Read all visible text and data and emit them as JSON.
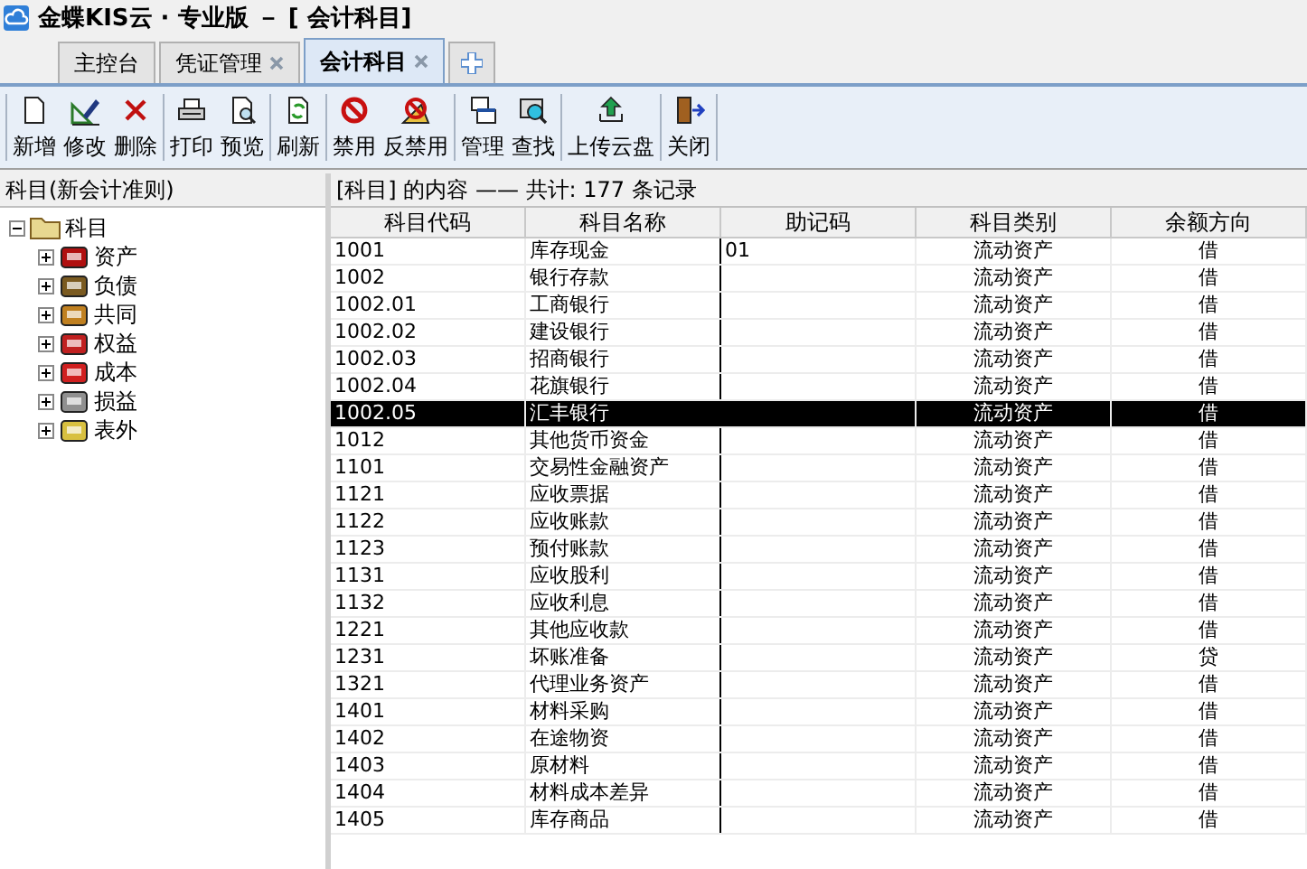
{
  "window": {
    "title": "金蝶KIS云 · 专业版 － [ 会计科目]"
  },
  "tabs": [
    {
      "label": "主控台",
      "selected": false,
      "closable": false
    },
    {
      "label": "凭证管理",
      "selected": false,
      "closable": true
    },
    {
      "label": "会计科目",
      "selected": true,
      "closable": true
    }
  ],
  "toolbar": [
    [
      {
        "label": "新增",
        "kind": "new"
      },
      {
        "label": "修改",
        "kind": "edit"
      },
      {
        "label": "删除",
        "kind": "delete"
      }
    ],
    [
      {
        "label": "打印",
        "kind": "print"
      },
      {
        "label": "预览",
        "kind": "preview"
      }
    ],
    [
      {
        "label": "刷新",
        "kind": "refresh"
      }
    ],
    [
      {
        "label": "禁用",
        "kind": "disable"
      },
      {
        "label": "反禁用",
        "kind": "enable"
      }
    ],
    [
      {
        "label": "管理",
        "kind": "manage"
      },
      {
        "label": "查找",
        "kind": "find"
      }
    ],
    [
      {
        "label": "上传云盘",
        "kind": "upload"
      }
    ],
    [
      {
        "label": "关闭",
        "kind": "close"
      }
    ]
  ],
  "sidebar": {
    "title": "科目(新会计准则)",
    "tree": {
      "label": "科目",
      "expanded": true,
      "children": [
        {
          "label": "资产",
          "kind": "asset",
          "expanded": false
        },
        {
          "label": "负债",
          "kind": "liability",
          "expanded": false
        },
        {
          "label": "共同",
          "kind": "common",
          "expanded": false
        },
        {
          "label": "权益",
          "kind": "equity",
          "expanded": false
        },
        {
          "label": "成本",
          "kind": "cost",
          "expanded": false
        },
        {
          "label": "损益",
          "kind": "profit",
          "expanded": false
        },
        {
          "label": "表外",
          "kind": "offbalance",
          "expanded": false
        }
      ]
    }
  },
  "table": {
    "caption": "[科目] 的内容 —— 共计: 177 条记录",
    "columns": [
      "科目代码",
      "科目名称",
      "助记码",
      "科目类别",
      "余额方向"
    ],
    "rows": [
      {
        "cells": [
          "1001",
          "库存现金",
          "01",
          "流动资产",
          "借"
        ],
        "selected": false
      },
      {
        "cells": [
          "1002",
          "银行存款",
          "",
          "流动资产",
          "借"
        ],
        "selected": false
      },
      {
        "cells": [
          "1002.01",
          "工商银行",
          "",
          "流动资产",
          "借"
        ],
        "selected": false
      },
      {
        "cells": [
          "1002.02",
          "建设银行",
          "",
          "流动资产",
          "借"
        ],
        "selected": false
      },
      {
        "cells": [
          "1002.03",
          "招商银行",
          "",
          "流动资产",
          "借"
        ],
        "selected": false
      },
      {
        "cells": [
          "1002.04",
          "花旗银行",
          "",
          "流动资产",
          "借"
        ],
        "selected": false
      },
      {
        "cells": [
          "1002.05",
          "汇丰银行",
          "",
          "流动资产",
          "借"
        ],
        "selected": true
      },
      {
        "cells": [
          "1012",
          "其他货币资金",
          "",
          "流动资产",
          "借"
        ],
        "selected": false
      },
      {
        "cells": [
          "1101",
          "交易性金融资产",
          "",
          "流动资产",
          "借"
        ],
        "selected": false
      },
      {
        "cells": [
          "1121",
          "应收票据",
          "",
          "流动资产",
          "借"
        ],
        "selected": false
      },
      {
        "cells": [
          "1122",
          "应收账款",
          "",
          "流动资产",
          "借"
        ],
        "selected": false
      },
      {
        "cells": [
          "1123",
          "预付账款",
          "",
          "流动资产",
          "借"
        ],
        "selected": false
      },
      {
        "cells": [
          "1131",
          "应收股利",
          "",
          "流动资产",
          "借"
        ],
        "selected": false
      },
      {
        "cells": [
          "1132",
          "应收利息",
          "",
          "流动资产",
          "借"
        ],
        "selected": false
      },
      {
        "cells": [
          "1221",
          "其他应收款",
          "",
          "流动资产",
          "借"
        ],
        "selected": false
      },
      {
        "cells": [
          "1231",
          "坏账准备",
          "",
          "流动资产",
          "贷"
        ],
        "selected": false
      },
      {
        "cells": [
          "1321",
          "代理业务资产",
          "",
          "流动资产",
          "借"
        ],
        "selected": false
      },
      {
        "cells": [
          "1401",
          "材料采购",
          "",
          "流动资产",
          "借"
        ],
        "selected": false
      },
      {
        "cells": [
          "1402",
          "在途物资",
          "",
          "流动资产",
          "借"
        ],
        "selected": false
      },
      {
        "cells": [
          "1403",
          "原材料",
          "",
          "流动资产",
          "借"
        ],
        "selected": false
      },
      {
        "cells": [
          "1404",
          "材料成本差异",
          "",
          "流动资产",
          "借"
        ],
        "selected": false
      },
      {
        "cells": [
          "1405",
          "库存商品",
          "",
          "流动资产",
          "借"
        ],
        "selected": false
      }
    ]
  }
}
